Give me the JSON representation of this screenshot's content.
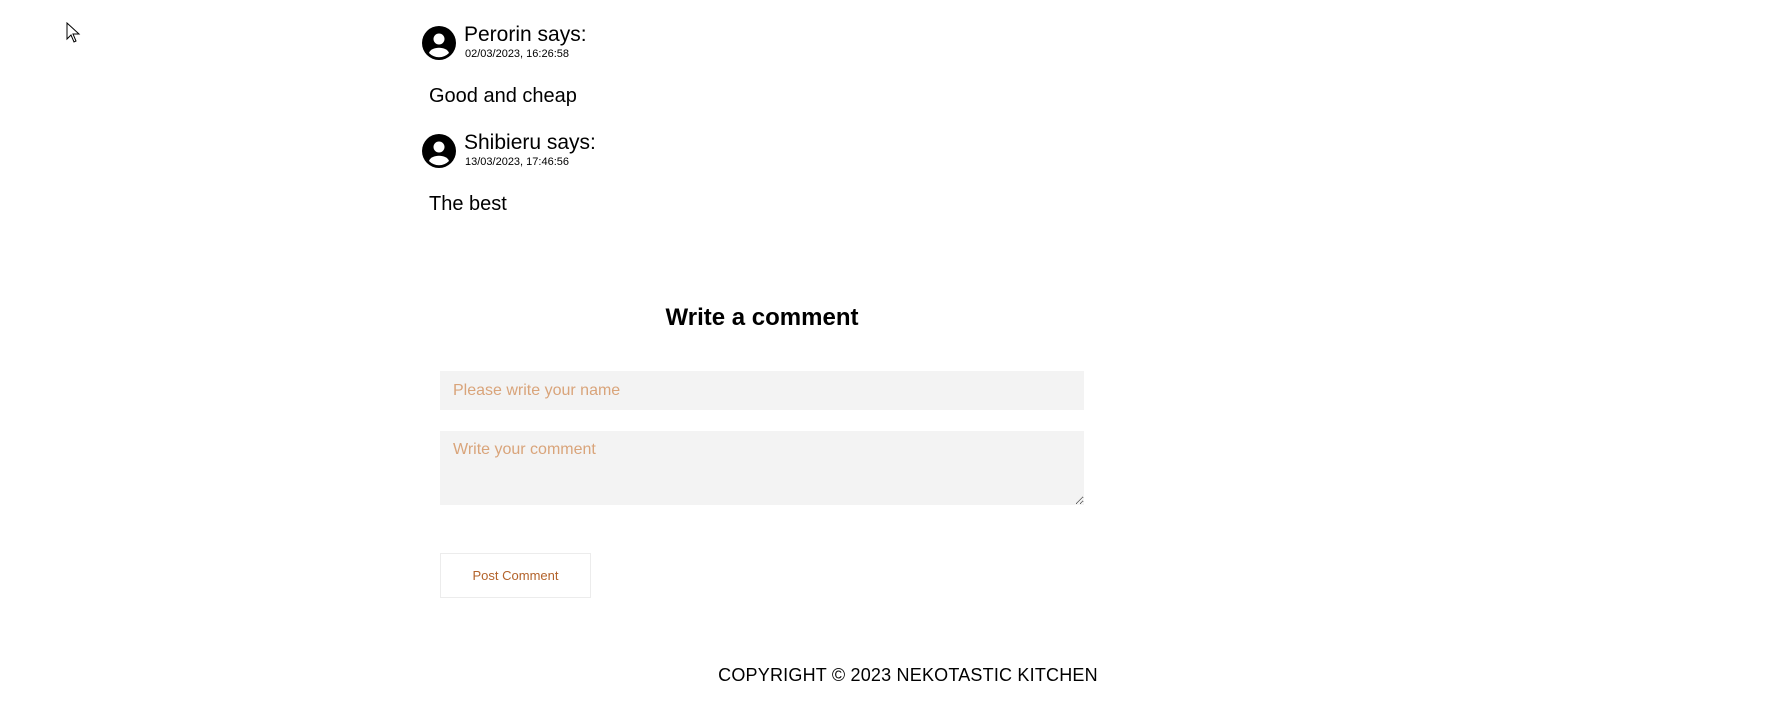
{
  "comments": [
    {
      "author_line": "Perorin says:",
      "timestamp": "02/03/2023, 16:26:58",
      "body": "Good and cheap"
    },
    {
      "author_line": "Shibieru says:",
      "timestamp": "13/03/2023, 17:46:56",
      "body": "The best"
    }
  ],
  "form": {
    "title": "Write a comment",
    "name_placeholder": "Please write your name",
    "name_value": "",
    "comment_placeholder": "Write your comment",
    "comment_value": "",
    "submit_label": "Post Comment"
  },
  "footer": {
    "copyright": "COPYRIGHT © 2023 NEKOTASTIC KITCHEN"
  },
  "icons": {
    "avatar": "user-circle-icon",
    "cursor": "mouse-pointer-icon"
  },
  "colors": {
    "placeholder": "#d9a47a",
    "button_text": "#b3632b",
    "field_background": "#f3f3f3"
  }
}
